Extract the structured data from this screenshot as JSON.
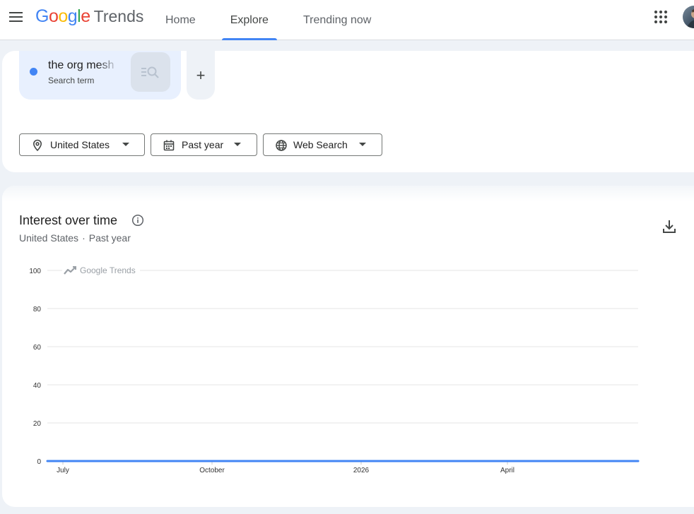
{
  "header": {
    "logo_google": "Google",
    "logo_trends": "Trends",
    "nav": [
      {
        "label": "Home",
        "active": false
      },
      {
        "label": "Explore",
        "active": true
      },
      {
        "label": "Trending now",
        "active": false
      }
    ],
    "icons": {
      "menu": "hamburger-menu-icon",
      "apps": "apps-grid-icon",
      "avatar": "user-avatar"
    }
  },
  "search": {
    "term": "the org mesh",
    "term_type": "Search term",
    "term_color": "#4285f4",
    "add_symbol": "+",
    "filters": [
      {
        "label": "United States",
        "icon": "location-pin-icon"
      },
      {
        "label": "Past year",
        "icon": "calendar-icon"
      },
      {
        "label": "Web Search",
        "icon": "globe-icon"
      }
    ]
  },
  "chart_card": {
    "title": "Interest over time",
    "subtitle_location": "United States",
    "subtitle_separator": "·",
    "subtitle_period": "Past year",
    "watermark": "Google Trends"
  },
  "chart_data": {
    "type": "line",
    "title": "Interest over time",
    "xlabel": "",
    "ylabel": "",
    "ylim": [
      0,
      100
    ],
    "y_ticks": [
      0,
      20,
      40,
      60,
      80,
      100
    ],
    "x_tick_labels": [
      "July",
      "October",
      "2026",
      "April"
    ],
    "grid": true,
    "series": [
      {
        "name": "the org mesh",
        "color": "#4285f4",
        "values": [
          0,
          0,
          0,
          0,
          0,
          0,
          0,
          0,
          0,
          0,
          0,
          0,
          0
        ]
      }
    ]
  }
}
